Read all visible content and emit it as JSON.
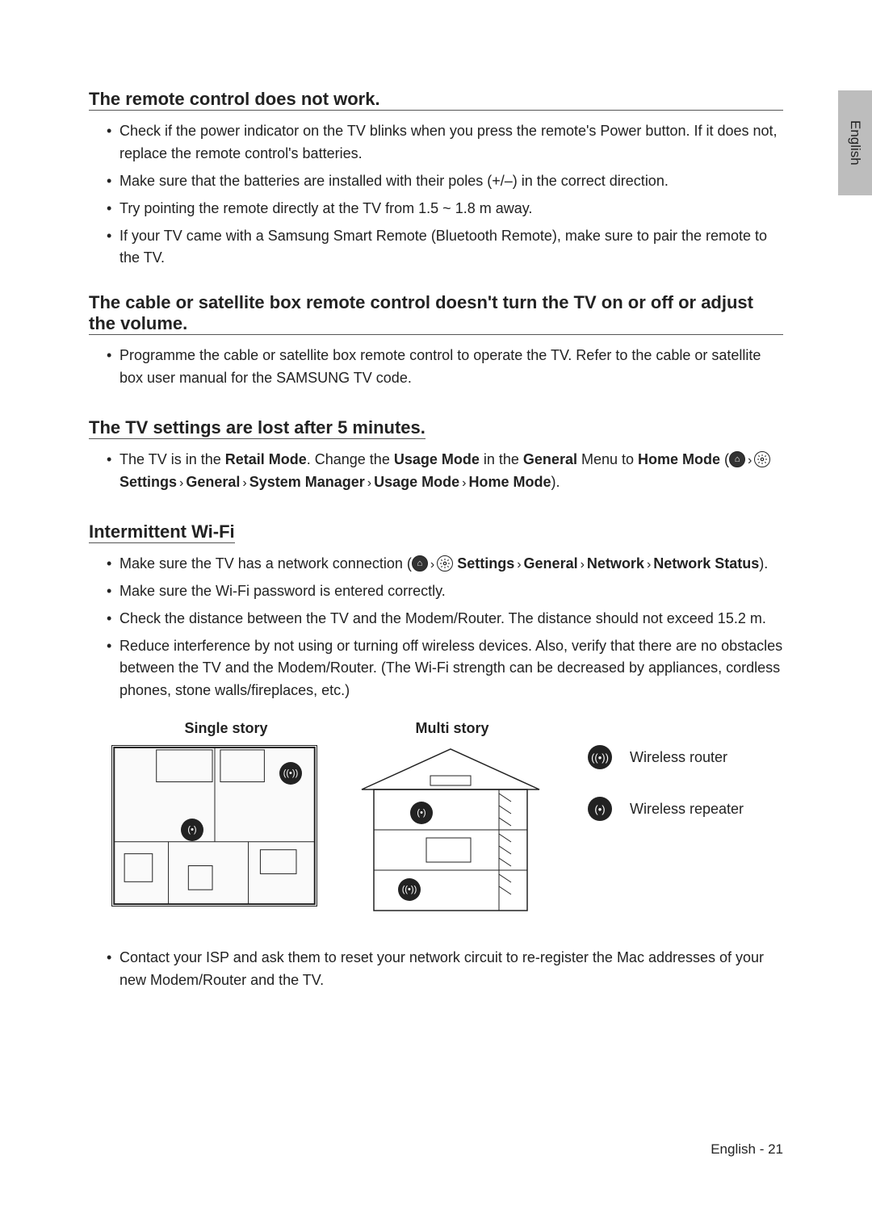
{
  "lang_tab": "English",
  "sections": {
    "remote": {
      "title": "The remote control does not work.",
      "items": [
        "Check if the power indicator on the TV blinks when you press the remote's Power button. If it does not, replace the remote control's batteries.",
        "Make sure that the batteries are installed with their poles (+/–) in the correct direction.",
        "Try pointing the remote directly at the TV from 1.5 ~ 1.8 m away.",
        "If your TV came with a Samsung Smart Remote (Bluetooth Remote), make sure to pair the remote to the TV."
      ]
    },
    "cable": {
      "title": "The cable or satellite box remote control doesn't turn the TV on or off or adjust the volume.",
      "items": [
        "Programme the cable or satellite box remote control to operate the TV. Refer to the cable or satellite box user manual for the SAMSUNG TV code."
      ]
    },
    "settings_lost": {
      "title": "The TV settings are lost after 5 minutes.",
      "item_prefix": "The TV is in the ",
      "retail_mode": "Retail Mode",
      "mid1": ". Change the ",
      "usage_mode": "Usage Mode",
      "mid2": " in the ",
      "general": "General",
      "mid3": " Menu to ",
      "home_mode": "Home Mode",
      "open_paren": " (",
      "settings_lbl": "Settings",
      "general2": "General",
      "sys_mgr": "System Manager",
      "usage_mode2": "Usage Mode",
      "home_mode2": "Home Mode",
      "close": ")."
    },
    "wifi": {
      "title": "Intermittent Wi-Fi",
      "item1_prefix": "Make sure the TV has a network connection (",
      "settings_lbl": "Settings",
      "general": "General",
      "network": "Network",
      "network_status": "Network Status",
      "close": ").",
      "items_rest": [
        "Make sure the Wi-Fi password is entered correctly.",
        "Check the distance between the TV and the Modem/Router. The distance should not exceed 15.2 m.",
        "Reduce interference by not using or turning off wireless devices. Also, verify that there are no obstacles between the TV and the Modem/Router. (The Wi-Fi strength can be decreased by appliances, cordless phones, stone walls/fireplaces, etc.)"
      ],
      "single_story": "Single story",
      "multi_story": "Multi story",
      "legend_router": "Wireless router",
      "legend_repeater": "Wireless repeater",
      "item_last": "Contact your ISP and ask them to reset your network circuit to re-register the Mac addresses of your new Modem/Router and the TV."
    }
  },
  "footer": "English - 21"
}
